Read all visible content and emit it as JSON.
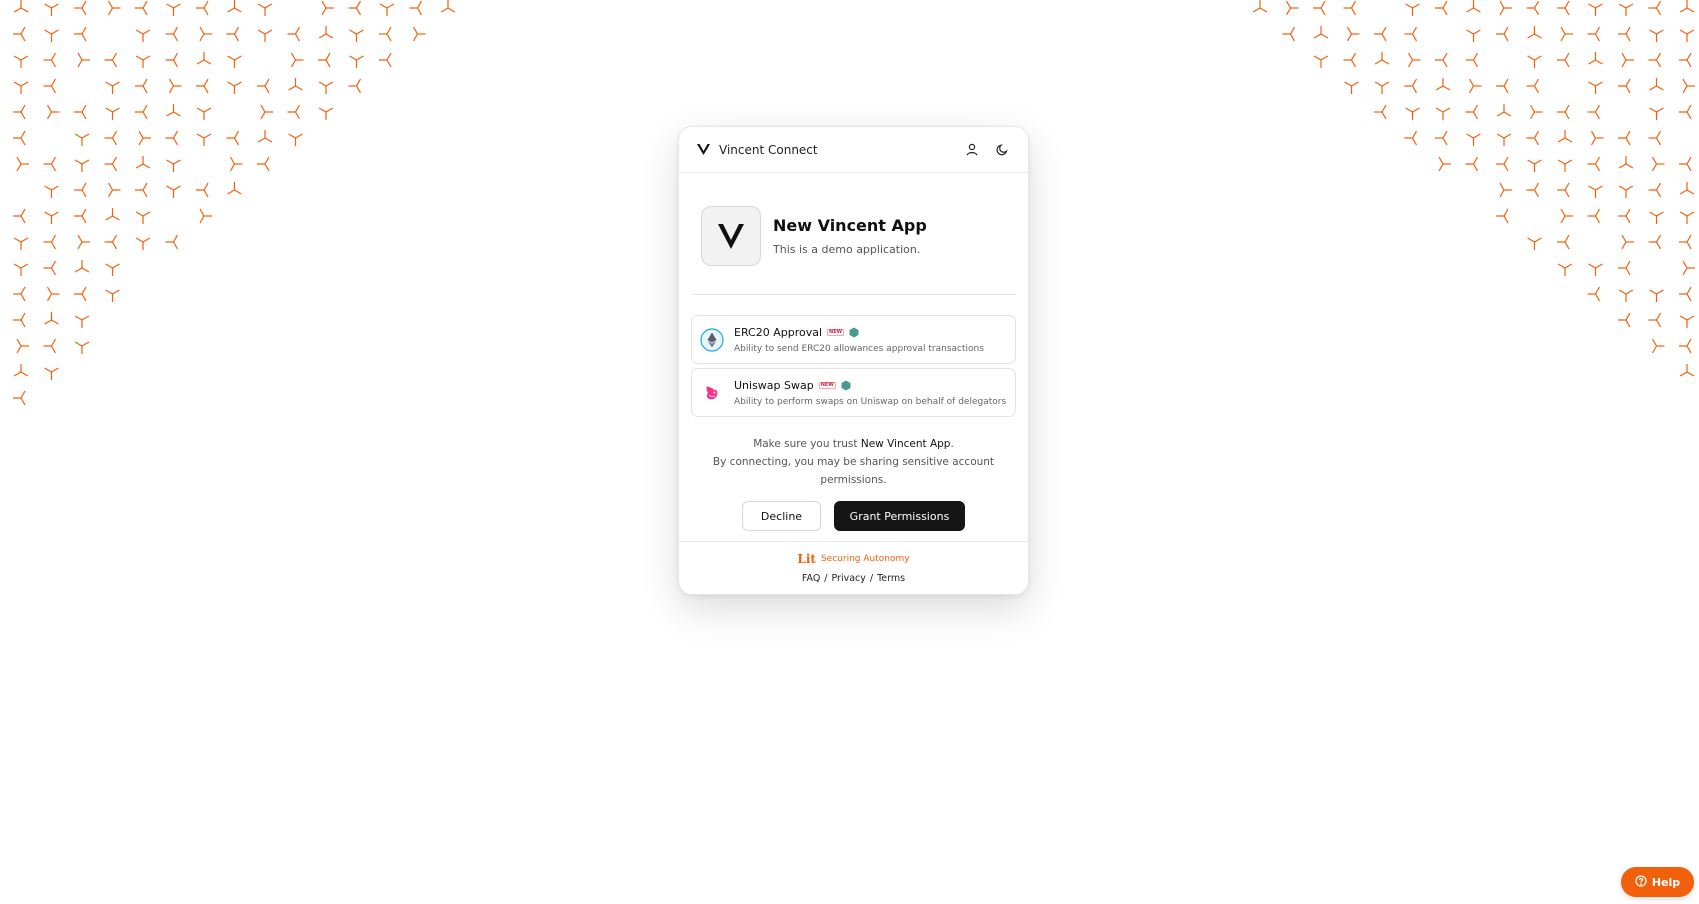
{
  "header": {
    "title": "Vincent Connect",
    "icons": [
      "vincent-logo-icon",
      "user-icon",
      "moon-icon"
    ]
  },
  "app": {
    "name": "New Vincent App",
    "description": "This is a demo application."
  },
  "abilities": [
    {
      "title": "ERC20 Approval",
      "description": "Ability to send ERC20 allowances approval transactions",
      "icon": "ethereum-icon"
    },
    {
      "title": "Uniswap Swap",
      "description": "Ability to perform swaps on Uniswap on behalf of delegators",
      "icon": "uniswap-icon"
    }
  ],
  "trust": {
    "prefix": "Make sure you trust ",
    "app_name": "New Vincent App",
    "suffix": ".",
    "line2": "By connecting, you may be sharing sensitive account permissions."
  },
  "buttons": {
    "decline": "Decline",
    "grant": "Grant Permissions"
  },
  "footer": {
    "logo_text": "Lit",
    "tagline": "Securing Autonomy",
    "links": [
      "FAQ",
      "Privacy",
      "Terms"
    ],
    "separator": "/"
  },
  "help": {
    "label": "Help",
    "icon": "question-circle-icon"
  },
  "colors": {
    "accent": "#f2600c",
    "primary_button": "#161616"
  }
}
